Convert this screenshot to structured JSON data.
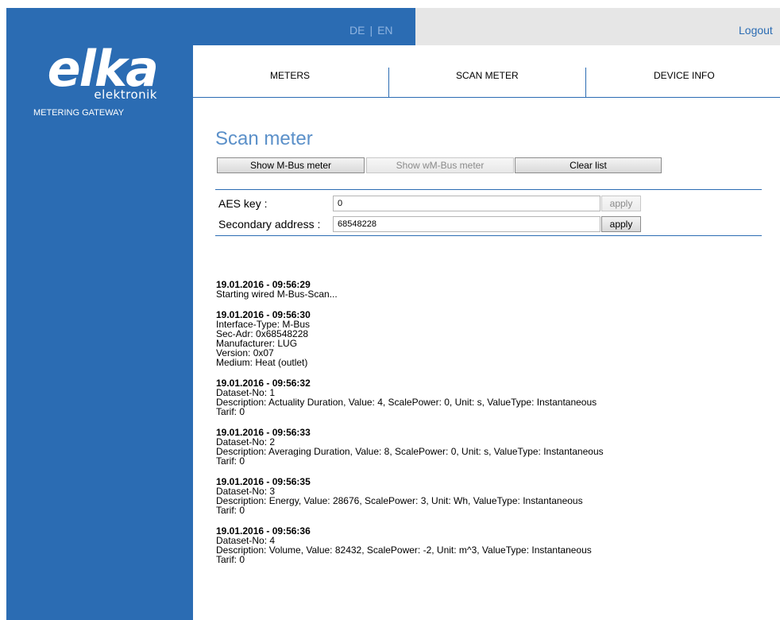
{
  "header": {
    "lang_de": "DE",
    "lang_separator": "|",
    "lang_en": "EN",
    "logout": "Logout"
  },
  "brand": {
    "wordmark": "elka",
    "subword": "elektronik",
    "tagline": "METERING GATEWAY"
  },
  "nav": {
    "items": [
      "METERS",
      "SCAN METER",
      "DEVICE INFO"
    ]
  },
  "page": {
    "title": "Scan meter"
  },
  "buttons": {
    "show_mbus": "Show M-Bus meter",
    "show_wmbus": "Show wM-Bus meter",
    "clear_list": "Clear list"
  },
  "form": {
    "aes_label": "AES key :",
    "aes_value": "0",
    "aes_apply": "apply",
    "secondary_label": "Secondary address :",
    "secondary_value": "68548228",
    "secondary_apply": "apply"
  },
  "log": [
    {
      "timestamp": "19.01.2016 - 09:56:29",
      "lines": [
        "Starting wired M-Bus-Scan..."
      ]
    },
    {
      "timestamp": "19.01.2016 - 09:56:30",
      "lines": [
        "Interface-Type: M-Bus",
        "Sec-Adr: 0x68548228",
        "Manufacturer: LUG",
        "Version: 0x07",
        "Medium: Heat (outlet)"
      ]
    },
    {
      "timestamp": "19.01.2016 - 09:56:32",
      "lines": [
        "Dataset-No: 1",
        "Description: Actuality Duration, Value: 4, ScalePower: 0, Unit: s, ValueType: Instantaneous",
        "Tarif: 0"
      ]
    },
    {
      "timestamp": "19.01.2016 - 09:56:33",
      "lines": [
        "Dataset-No: 2",
        "Description: Averaging Duration, Value: 8, ScalePower: 0, Unit: s, ValueType: Instantaneous",
        "Tarif: 0"
      ]
    },
    {
      "timestamp": "19.01.2016 - 09:56:35",
      "lines": [
        "Dataset-No: 3",
        "Description: Energy, Value: 28676, ScalePower: 3, Unit: Wh, ValueType: Instantaneous",
        "Tarif: 0"
      ]
    },
    {
      "timestamp": "19.01.2016 - 09:56:36",
      "lines": [
        "Dataset-No: 4",
        "Description: Volume, Value: 82432, ScalePower: -2, Unit: m^3, ValueType: Instantaneous",
        "Tarif: 0"
      ]
    }
  ],
  "colors": {
    "brand_blue": "#2b6cb3",
    "title_blue": "#5b90c9",
    "topbar_gray": "#e6e6e6"
  }
}
